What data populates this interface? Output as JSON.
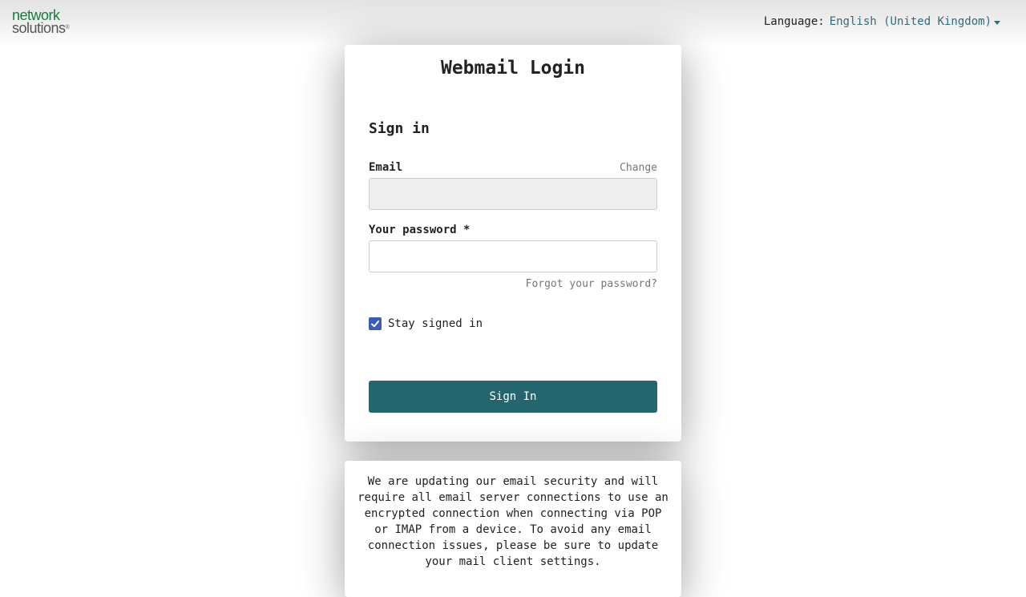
{
  "header": {
    "logo_line1": "network",
    "logo_line2": "solutions",
    "logo_mark": "®",
    "language_label": "Language:",
    "language_value": "English (United Kingdom)"
  },
  "login": {
    "title": "Webmail Login",
    "heading": "Sign in",
    "email_label": "Email",
    "change_label": "Change",
    "email_value": "",
    "password_label": "Your password *",
    "password_value": "",
    "forgot_label": "Forgot your password?",
    "stay_signed_in_label": "Stay signed in",
    "stay_signed_in_checked": true,
    "sign_in_button": "Sign In"
  },
  "notice": {
    "text": "We are updating our email security and will require all email server connections to use an encrypted connection when connecting via POP or IMAP from a device. To avoid any email connection issues, please be sure to update your mail client settings."
  },
  "colors": {
    "brand_green": "#1a7a3c",
    "button": "#24656f",
    "link": "#2e6e80",
    "checkbox": "#3b5bb5"
  }
}
